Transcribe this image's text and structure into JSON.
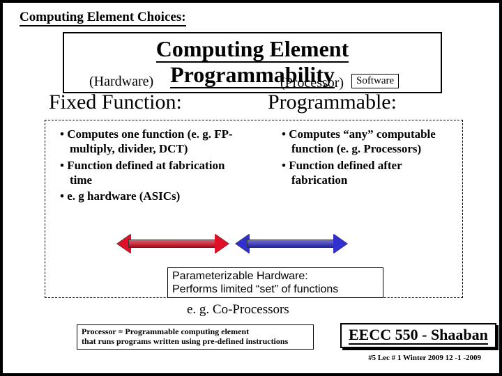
{
  "header_small": "Computing Element Choices:",
  "title": "Computing Element Programmability",
  "left": {
    "paren": "(Hardware)",
    "heading": "Fixed Function:",
    "bullets": [
      "Computes one function (e. g. FP-multiply, divider, DCT)",
      "Function defined at fabrication time",
      "e. g hardware (ASICs)"
    ]
  },
  "right": {
    "paren": "(Processor)",
    "sw_label": "Software",
    "heading": "Programmable:",
    "bullets": [
      "Computes “any” computable function (e. g. Processors)",
      "Function defined after fabrication"
    ]
  },
  "arrows": {
    "left_color": "#E01028",
    "right_color": "#3030D0"
  },
  "param_box": {
    "line1": "Parameterizable Hardware:",
    "line2": "Performs limited “set” of functions"
  },
  "copro": "e. g. Co-Processors",
  "definition": {
    "line1": "Processor = Programmable computing element",
    "line2": "that runs programs written using pre-defined instructions"
  },
  "course": "EECC 550 - Shaaban",
  "footer": "#5   Lec # 1  Winter 2009  12 -1 -2009"
}
